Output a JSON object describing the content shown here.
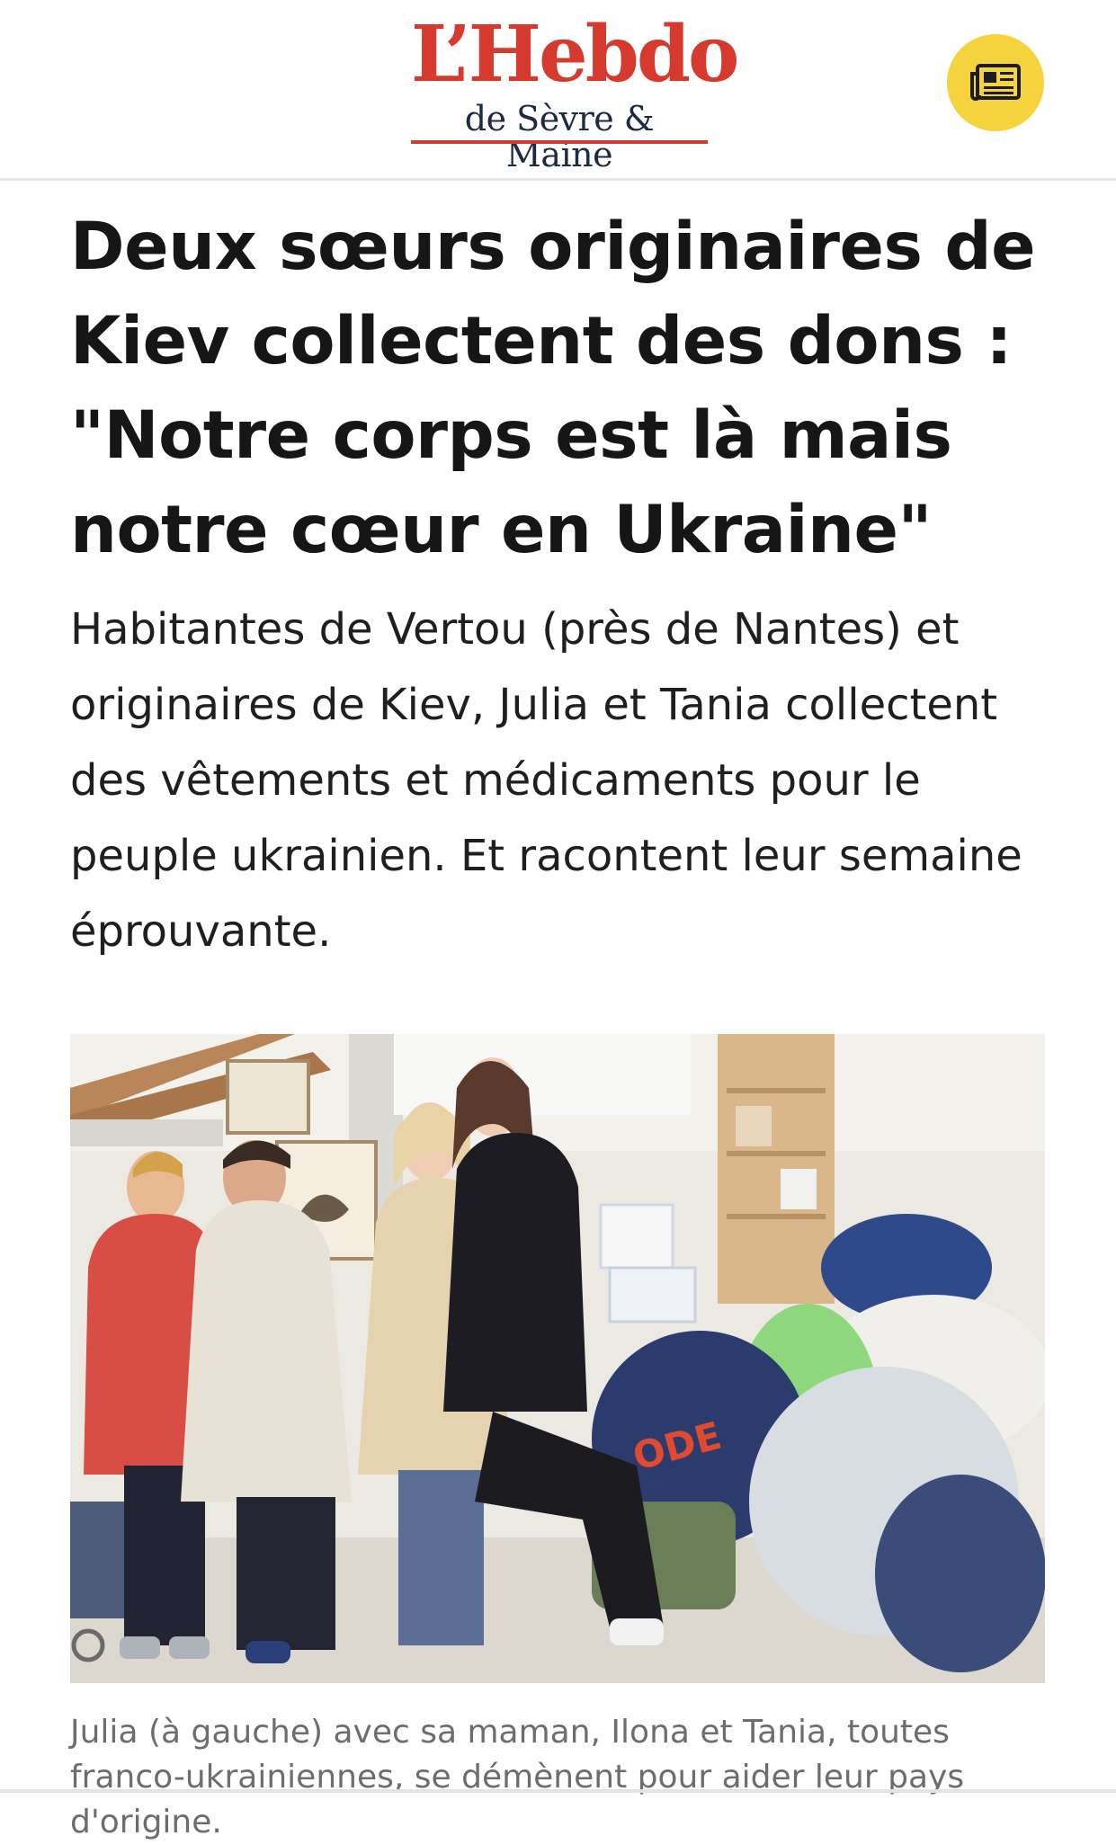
{
  "header": {
    "logo_main": "L’Hebdo",
    "logo_sub": "de Sèvre & Maine",
    "menu_icon": "newspaper-icon",
    "accent_color": "#d63a2e",
    "button_color": "#f4d33c"
  },
  "article": {
    "headline": "Deux sœurs originaires de Kiev collectent des dons : \"Notre corps est là mais notre cœur en Ukraine\"",
    "lead": "Habitantes de Vertou (près de Nantes) et originaires de Kiev, Julia et Tania collectent des vêtements et médicaments pour le peuple ukrainien. Et racontent leur semaine éprouvante.",
    "photo_flag_colors": [
      "#2a62c9",
      "#f2d02c"
    ],
    "caption": "Julia (à gauche) avec sa maman, Ilona et Tania, toutes franco-ukrainiennes, se démènent pour aider leur pays d'origine."
  }
}
